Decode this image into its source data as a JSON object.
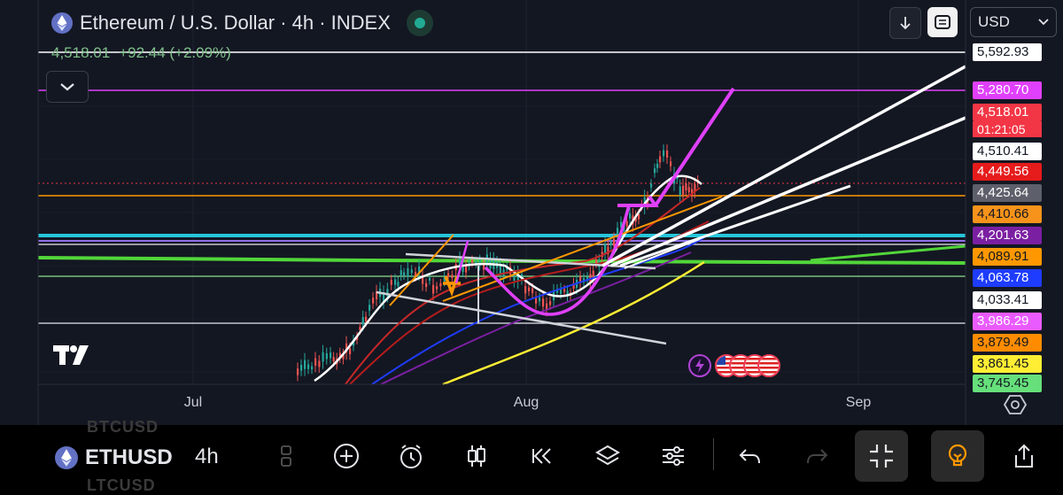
{
  "header": {
    "title": "Ethereum / U.S. Dollar · 4h · INDEX",
    "price": "4,518.01",
    "change": "+92.44 (+2.09%)"
  },
  "currency": {
    "selected": "USD"
  },
  "x_axis": {
    "months": [
      "Jul",
      "Aug",
      "Sep"
    ]
  },
  "price_scale": [
    {
      "label": "5,592.93",
      "bg": "#ffffff",
      "fg": "#131722"
    },
    {
      "label": "5,280.70",
      "bg": "#e040fb",
      "fg": "#ffffff"
    },
    {
      "label": "4,518.01",
      "bg": "#f23645",
      "fg": "#ffffff"
    },
    {
      "label": "01:21:05",
      "bg": "#f23645",
      "fg": "#ffffff"
    },
    {
      "label": "4,510.41",
      "bg": "#ffffff",
      "fg": "#131722"
    },
    {
      "label": "4,449.56",
      "bg": "#e61b1b",
      "fg": "#ffffff"
    },
    {
      "label": "4,425.64",
      "bg": "#5d606b",
      "fg": "#ffffff"
    },
    {
      "label": "4,410.66",
      "bg": "#f7931a",
      "fg": "#131722"
    },
    {
      "label": "4,201.63",
      "bg": "#7b1fa2",
      "fg": "#ffffff"
    },
    {
      "label": "4,089.91",
      "bg": "#ff9800",
      "fg": "#131722"
    },
    {
      "label": "4,063.78",
      "bg": "#1e3cff",
      "fg": "#ffffff"
    },
    {
      "label": "4,033.41",
      "bg": "#ffffff",
      "fg": "#131722"
    },
    {
      "label": "3,986.29",
      "bg": "#ea5bff",
      "fg": "#ffffff"
    },
    {
      "label": "3,879.49",
      "bg": "#ff8c00",
      "fg": "#131722"
    },
    {
      "label": "3,861.45",
      "bg": "#ffee33",
      "fg": "#131722"
    },
    {
      "label": "3,745.45",
      "bg": "#66e07a",
      "fg": "#131722"
    }
  ],
  "toolbar": {
    "symbol": "ETHUSD",
    "interval": "4h",
    "ghost_symbols": [
      "BTCUSD",
      "LTCUSD"
    ]
  },
  "colors": {
    "background": "#131722",
    "up": "#26a69a",
    "down": "#ef5350",
    "accent_live": "#22ab94"
  },
  "icons": [
    "ethereum-icon",
    "download-icon",
    "fullscreen-icon",
    "chevron-down-icon",
    "tradingview-logo",
    "settings-icon",
    "add-icon",
    "alert-icon",
    "candles-icon",
    "replay-icon",
    "layers-icon",
    "indicators-icon",
    "undo-icon",
    "redo-icon",
    "collapse-icon",
    "idea-icon",
    "share-icon"
  ]
}
